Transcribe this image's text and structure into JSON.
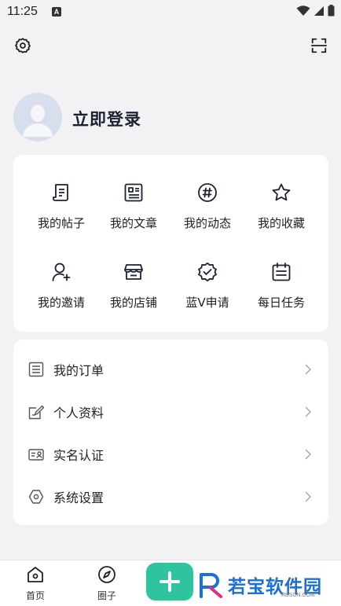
{
  "status_bar": {
    "time": "11:25",
    "notification_badge": "A"
  },
  "top": {
    "settings_icon": "gear-icon",
    "scan_icon": "scan-icon"
  },
  "profile": {
    "login_label": "立即登录"
  },
  "grid": {
    "items": [
      {
        "label": "我的帖子",
        "icon": "post-icon"
      },
      {
        "label": "我的文章",
        "icon": "article-icon"
      },
      {
        "label": "我的动态",
        "icon": "hashtag-icon"
      },
      {
        "label": "我的收藏",
        "icon": "star-icon"
      },
      {
        "label": "我的邀请",
        "icon": "invite-user-icon"
      },
      {
        "label": "我的店铺",
        "icon": "shop-icon"
      },
      {
        "label": "蓝V申请",
        "icon": "verified-badge-icon"
      },
      {
        "label": "每日任务",
        "icon": "calendar-task-icon"
      }
    ]
  },
  "list": {
    "items": [
      {
        "label": "我的订单",
        "icon": "order-list-icon"
      },
      {
        "label": "个人资料",
        "icon": "edit-profile-icon"
      },
      {
        "label": "实名认证",
        "icon": "id-card-icon"
      },
      {
        "label": "系统设置",
        "icon": "hexagon-settings-icon"
      }
    ]
  },
  "bottom_nav": {
    "items": [
      {
        "label": "首页",
        "icon": "home-icon"
      },
      {
        "label": "圈子",
        "icon": "compass-icon"
      }
    ],
    "plus_icon": "plus-icon"
  },
  "watermark": {
    "text": "若宝软件园",
    "sub": "RBSCN.COM"
  },
  "colors": {
    "accent": "#2ec4a0",
    "watermark": "#1a6fd8",
    "background": "#f2f2f4"
  }
}
